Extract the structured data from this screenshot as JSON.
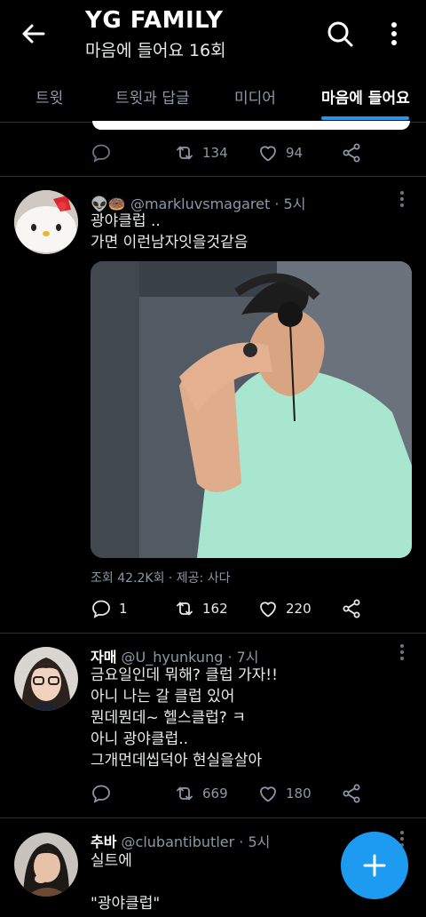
{
  "header": {
    "title": "YG FAMILY",
    "subtitle": "마음에 들어요 16회"
  },
  "tabs": [
    {
      "label": "트윗",
      "active": false
    },
    {
      "label": "트윗과 답글",
      "active": false
    },
    {
      "label": "미디어",
      "active": false
    },
    {
      "label": "마음에 들어요",
      "active": true
    }
  ],
  "first_tweet_actions": {
    "reply": "",
    "retweets": "134",
    "likes": "94"
  },
  "tweets": [
    {
      "emoji_name": "👽🍩",
      "handle": "@markluvsmagaret",
      "time": "· 5시",
      "lines": "광야클럽 ..\n가면 이런남자잇을것같음",
      "views": "조회 42.2K회 · 제공: 사다",
      "replies": "1",
      "retweets": "162",
      "likes": "220"
    },
    {
      "name": "자매",
      "handle": "@U_hyunkung",
      "time": "· 7시",
      "lines": "금요일인데 뭐해? 클럽 가자!!\n아니 나는 갈 클럽 있어\n뭔데뭔데~ 헬스클럽? ㅋ\n아니 광야클럽..\n그개먼데씹덕아 현실을살아",
      "replies": "",
      "retweets": "669",
      "likes": "180"
    },
    {
      "name": "추바",
      "handle": "@clubantibutler",
      "time": "· 5시",
      "lines": "실트에\n\n\"광야클럽\""
    }
  ],
  "colors": {
    "accent": "#1d9bf0",
    "background": "#000000",
    "muted": "#8b98a5"
  }
}
